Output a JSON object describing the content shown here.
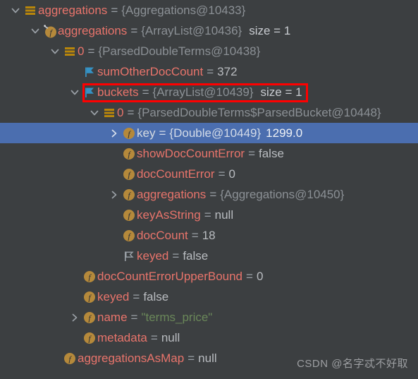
{
  "window": {
    "title": "Debugger Variables Tree",
    "background_color": "#3c3f41",
    "selection_color": "#4b6eaf",
    "name_color": "#e8746b",
    "reference_color": "#8b9095",
    "string_color": "#6a8759",
    "annotation_color": "#ff0000"
  },
  "annotation": {
    "type": "red-rectangle",
    "target_row_index": 4,
    "label": "buckets highlight"
  },
  "watermark": {
    "text": "CSDN @名字忒不好取"
  },
  "tree": {
    "rows": [
      {
        "index": 0,
        "depth": 0,
        "twisty": "expanded",
        "icon": "list-icon",
        "name": "aggregations",
        "eq": "=",
        "reference": "{Aggregations@10433}",
        "value": "",
        "value_type": "none",
        "size": "",
        "selected": false
      },
      {
        "index": 1,
        "depth": 1,
        "twisty": "expanded",
        "icon": "final-field-icon",
        "name": "aggregations",
        "eq": "=",
        "reference": "{ArrayList@10436}",
        "value": "",
        "value_type": "none",
        "size": "size = 1",
        "selected": false
      },
      {
        "index": 2,
        "depth": 2,
        "twisty": "expanded",
        "icon": "list-icon",
        "name": "0",
        "eq": "=",
        "reference": "{ParsedDoubleTerms@10438}",
        "value": "",
        "value_type": "none",
        "size": "",
        "selected": false
      },
      {
        "index": 3,
        "depth": 3,
        "twisty": "none",
        "icon": "blue-flag-icon",
        "name": "sumOtherDocCount",
        "eq": "=",
        "reference": "",
        "value": "372",
        "value_type": "number",
        "size": "",
        "selected": false
      },
      {
        "index": 4,
        "depth": 3,
        "twisty": "expanded",
        "icon": "blue-flag-icon",
        "name": "buckets",
        "eq": "=",
        "reference": "{ArrayList@10439}",
        "value": "",
        "value_type": "none",
        "size": "size = 1",
        "selected": false
      },
      {
        "index": 5,
        "depth": 4,
        "twisty": "expanded",
        "icon": "list-icon",
        "name": "0",
        "eq": "=",
        "reference": "{ParsedDoubleTerms$ParsedBucket@10448}",
        "value": "",
        "value_type": "none",
        "size": "",
        "selected": false
      },
      {
        "index": 6,
        "depth": 5,
        "twisty": "collapsed",
        "icon": "field-icon",
        "name": "key",
        "eq": "=",
        "reference": "{Double@10449}",
        "value": "1299.0",
        "value_type": "number",
        "size": "",
        "selected": true
      },
      {
        "index": 7,
        "depth": 5,
        "twisty": "none",
        "icon": "field-icon",
        "name": "showDocCountError",
        "eq": "=",
        "reference": "",
        "value": "false",
        "value_type": "boolean",
        "size": "",
        "selected": false
      },
      {
        "index": 8,
        "depth": 5,
        "twisty": "none",
        "icon": "field-icon",
        "name": "docCountError",
        "eq": "=",
        "reference": "",
        "value": "0",
        "value_type": "number",
        "size": "",
        "selected": false
      },
      {
        "index": 9,
        "depth": 5,
        "twisty": "collapsed",
        "icon": "field-icon",
        "name": "aggregations",
        "eq": "=",
        "reference": "{Aggregations@10450}",
        "value": "",
        "value_type": "none",
        "size": "",
        "selected": false
      },
      {
        "index": 10,
        "depth": 5,
        "twisty": "none",
        "icon": "field-icon",
        "name": "keyAsString",
        "eq": "=",
        "reference": "",
        "value": "null",
        "value_type": "null",
        "size": "",
        "selected": false
      },
      {
        "index": 11,
        "depth": 5,
        "twisty": "none",
        "icon": "field-icon",
        "name": "docCount",
        "eq": "=",
        "reference": "",
        "value": "18",
        "value_type": "number",
        "size": "",
        "selected": false
      },
      {
        "index": 12,
        "depth": 5,
        "twisty": "none",
        "icon": "outline-flag-icon",
        "name": "keyed",
        "eq": "=",
        "reference": "",
        "value": "false",
        "value_type": "boolean",
        "size": "",
        "selected": false
      },
      {
        "index": 13,
        "depth": 3,
        "twisty": "none",
        "icon": "field-icon",
        "name": "docCountErrorUpperBound",
        "eq": "=",
        "reference": "",
        "value": "0",
        "value_type": "number",
        "size": "",
        "selected": false
      },
      {
        "index": 14,
        "depth": 3,
        "twisty": "none",
        "icon": "field-icon",
        "name": "keyed",
        "eq": "=",
        "reference": "",
        "value": "false",
        "value_type": "boolean",
        "size": "",
        "selected": false
      },
      {
        "index": 15,
        "depth": 3,
        "twisty": "collapsed",
        "icon": "field-icon",
        "name": "name",
        "eq": "=",
        "reference": "",
        "value": "\"terms_price\"",
        "value_type": "string",
        "size": "",
        "selected": false
      },
      {
        "index": 16,
        "depth": 3,
        "twisty": "none",
        "icon": "field-icon",
        "name": "metadata",
        "eq": "=",
        "reference": "",
        "value": "null",
        "value_type": "null",
        "size": "",
        "selected": false
      },
      {
        "index": 17,
        "depth": 2,
        "twisty": "none",
        "icon": "field-icon",
        "name": "aggregationsAsMap",
        "eq": "=",
        "reference": "",
        "value": "null",
        "value_type": "null",
        "size": "",
        "selected": false
      }
    ]
  }
}
